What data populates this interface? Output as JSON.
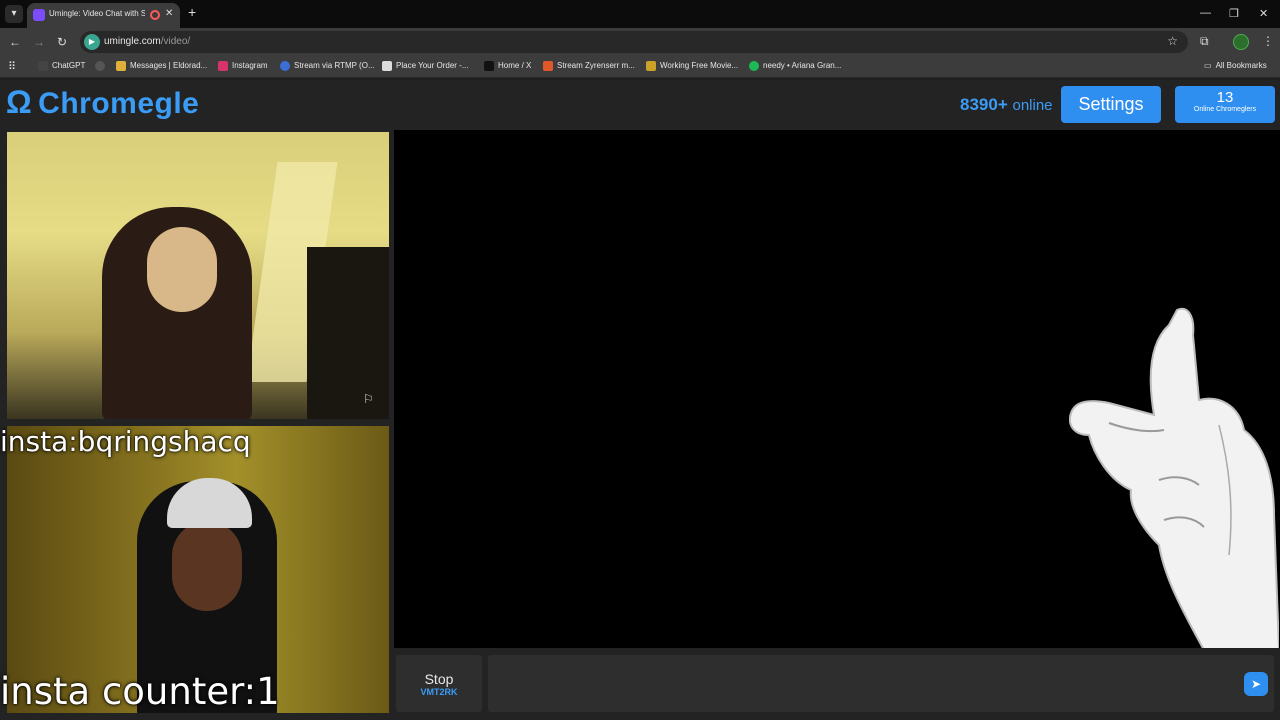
{
  "browser": {
    "tab_title": "Umingle: Video Chat with S",
    "url_host": "umingle.com",
    "url_path": "/video/",
    "bookmarks": [
      {
        "label": "ChatGPT",
        "color": "#444444",
        "icon": "chatgpt-icon"
      },
      {
        "label": "",
        "color": "#555555",
        "icon": "globe-icon"
      },
      {
        "label": "Messages | Eldorad...",
        "color": "#e0b13a",
        "icon": "messages-icon"
      },
      {
        "label": "Instagram",
        "color": "#d6336c",
        "icon": "instagram-icon"
      },
      {
        "label": "Stream via RTMP (O...",
        "color": "#3b6fd6",
        "icon": "stream-icon"
      },
      {
        "label": "Place Your Order -...",
        "color": "#dddddd",
        "icon": "order-icon"
      },
      {
        "label": "Home / X",
        "color": "#111111",
        "icon": "x-icon"
      },
      {
        "label": "Stream Zyrenserr m...",
        "color": "#e0572a",
        "icon": "stream-icon"
      },
      {
        "label": "Working Free Movie...",
        "color": "#c9a227",
        "icon": "movie-icon"
      },
      {
        "label": "needy • Ariana Gran...",
        "color": "#1db954",
        "icon": "spotify-icon"
      }
    ],
    "all_bookmarks": "All Bookmarks"
  },
  "header": {
    "logo_text": "Chromegle",
    "online_count": "8390+",
    "online_label": "online",
    "settings_label": "Settings",
    "chromeglers_count": "13",
    "chromeglers_label": "Online Chromeglers"
  },
  "overlay": {
    "insta_handle": "insta:bqringshacq",
    "insta_counter": "insta counter:1"
  },
  "controls": {
    "stop_label": "Stop",
    "stop_code": "VMT2RK",
    "chat_placeholder": ""
  },
  "colors": {
    "accent": "#2f8ff0",
    "logo": "#3b9cf5"
  }
}
